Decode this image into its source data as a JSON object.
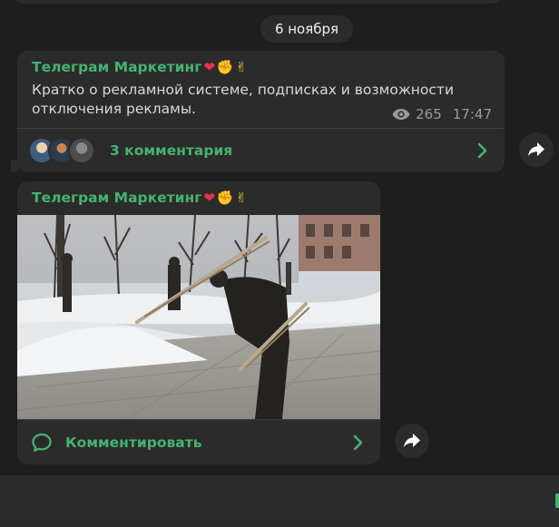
{
  "colors": {
    "background": "#1e1e1f",
    "bubble": "#2b2b2c",
    "accent": "#45b36f",
    "meta": "#9a9a9a"
  },
  "date_separator": "6 ноября",
  "post1": {
    "channel_name": "Телеграм Маркетинг",
    "emojis": [
      "❤",
      "✊",
      "✌"
    ],
    "text": "Кратко о рекламной системе, подписках и возможности отключения рекламы.",
    "views": "265",
    "time": "17:47",
    "comments_label": "3 комментария",
    "icons": [
      "eye-icon",
      "chevron-right-icon",
      "share-icon"
    ]
  },
  "post2": {
    "channel_name": "Телеграм Маркетинг",
    "emojis": [
      "❤",
      "✊",
      "✌"
    ],
    "comment_button_label": "Комментировать",
    "icons": [
      "comment-bubble-icon",
      "chevron-right-icon",
      "share-icon"
    ]
  }
}
